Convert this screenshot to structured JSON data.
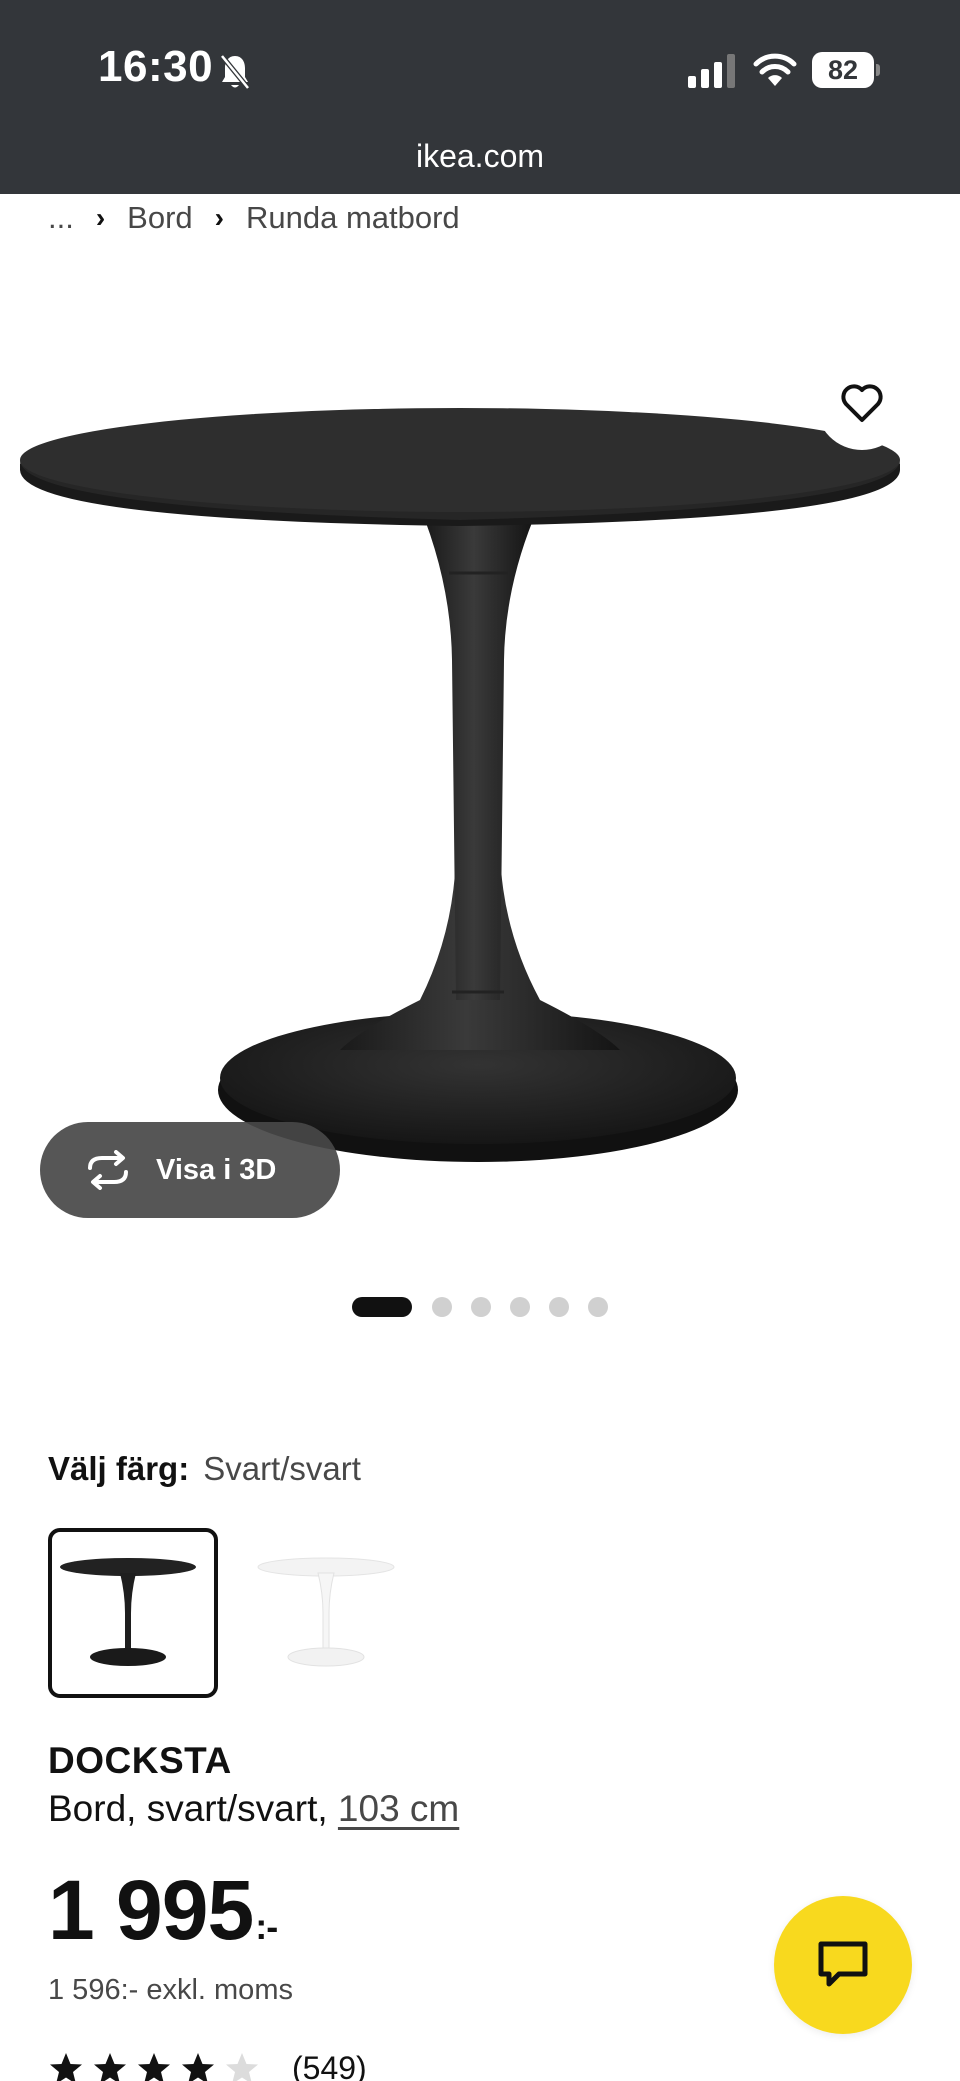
{
  "status_bar": {
    "time": "16:30",
    "battery": "82",
    "icons": [
      "bell-slash-icon",
      "cellular-signal-icon",
      "wifi-icon",
      "battery-icon"
    ]
  },
  "browser": {
    "url": "ikea.com"
  },
  "breadcrumb": {
    "items": [
      "...",
      "Bord",
      "Runda matbord"
    ]
  },
  "gallery": {
    "view_3d_label": "Visa i 3D",
    "active_index": 0,
    "count": 6
  },
  "color": {
    "label": "Välj färg:",
    "selected": "Svart/svart",
    "options": [
      "black-table-swatch",
      "white-table-swatch"
    ]
  },
  "product": {
    "name": "DOCKSTA",
    "description_prefix": "Bord, svart/svart,",
    "size": "103 cm",
    "price": "1 995",
    "price_suffix": ":-",
    "price_ex_vat": "1 596:- exkl. moms",
    "rating": 4,
    "rating_max": 5,
    "review_count": "(549)"
  },
  "colors": {
    "topbar": "#33363a",
    "chat": "#f8d91e",
    "pill": "#484848"
  }
}
